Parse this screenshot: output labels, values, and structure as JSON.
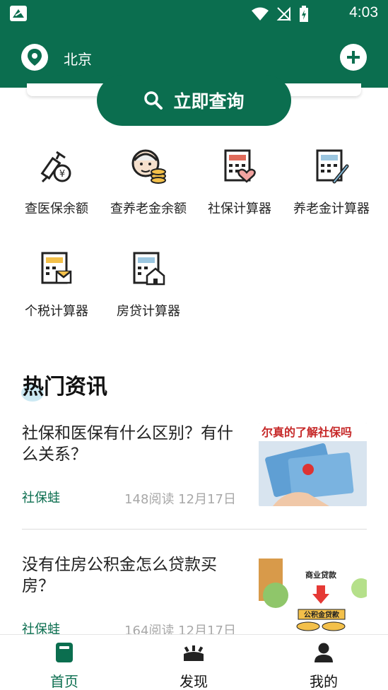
{
  "status_bar": {
    "time": "4:03"
  },
  "header": {
    "city": "北京"
  },
  "search": {
    "button_label": "立即查询"
  },
  "tools": [
    {
      "label": "查医保余额",
      "icon": "syringe-coin-icon"
    },
    {
      "label": "查养老金余额",
      "icon": "elder-coins-icon"
    },
    {
      "label": "社保计算器",
      "icon": "calculator-heart-icon"
    },
    {
      "label": "养老金计算器",
      "icon": "calculator-pen-icon"
    },
    {
      "label": "个税计算器",
      "icon": "calculator-envelope-icon"
    },
    {
      "label": "房贷计算器",
      "icon": "calculator-house-icon"
    }
  ],
  "news_section": {
    "title": "热门资讯",
    "items": [
      {
        "title": "社保和医保有什么区别？有什么关系？",
        "source": "社保蛙",
        "meta": "148阅读 12月17日",
        "thumb_caption": "尔真的了解社保吗"
      },
      {
        "title": "没有住房公积金怎么贷款买房？",
        "source": "社保蛙",
        "meta": "164阅读 12月17日",
        "thumb_caption_top": "商业贷款",
        "thumb_caption_bottom": "公积金贷款"
      }
    ]
  },
  "bottom_nav": [
    {
      "label": "首页",
      "icon": "home-icon",
      "active": true
    },
    {
      "label": "发现",
      "icon": "discover-icon",
      "active": false
    },
    {
      "label": "我的",
      "icon": "profile-icon",
      "active": false
    }
  ],
  "colors": {
    "primary": "#0b6e4f",
    "muted": "#a8a8a8"
  }
}
